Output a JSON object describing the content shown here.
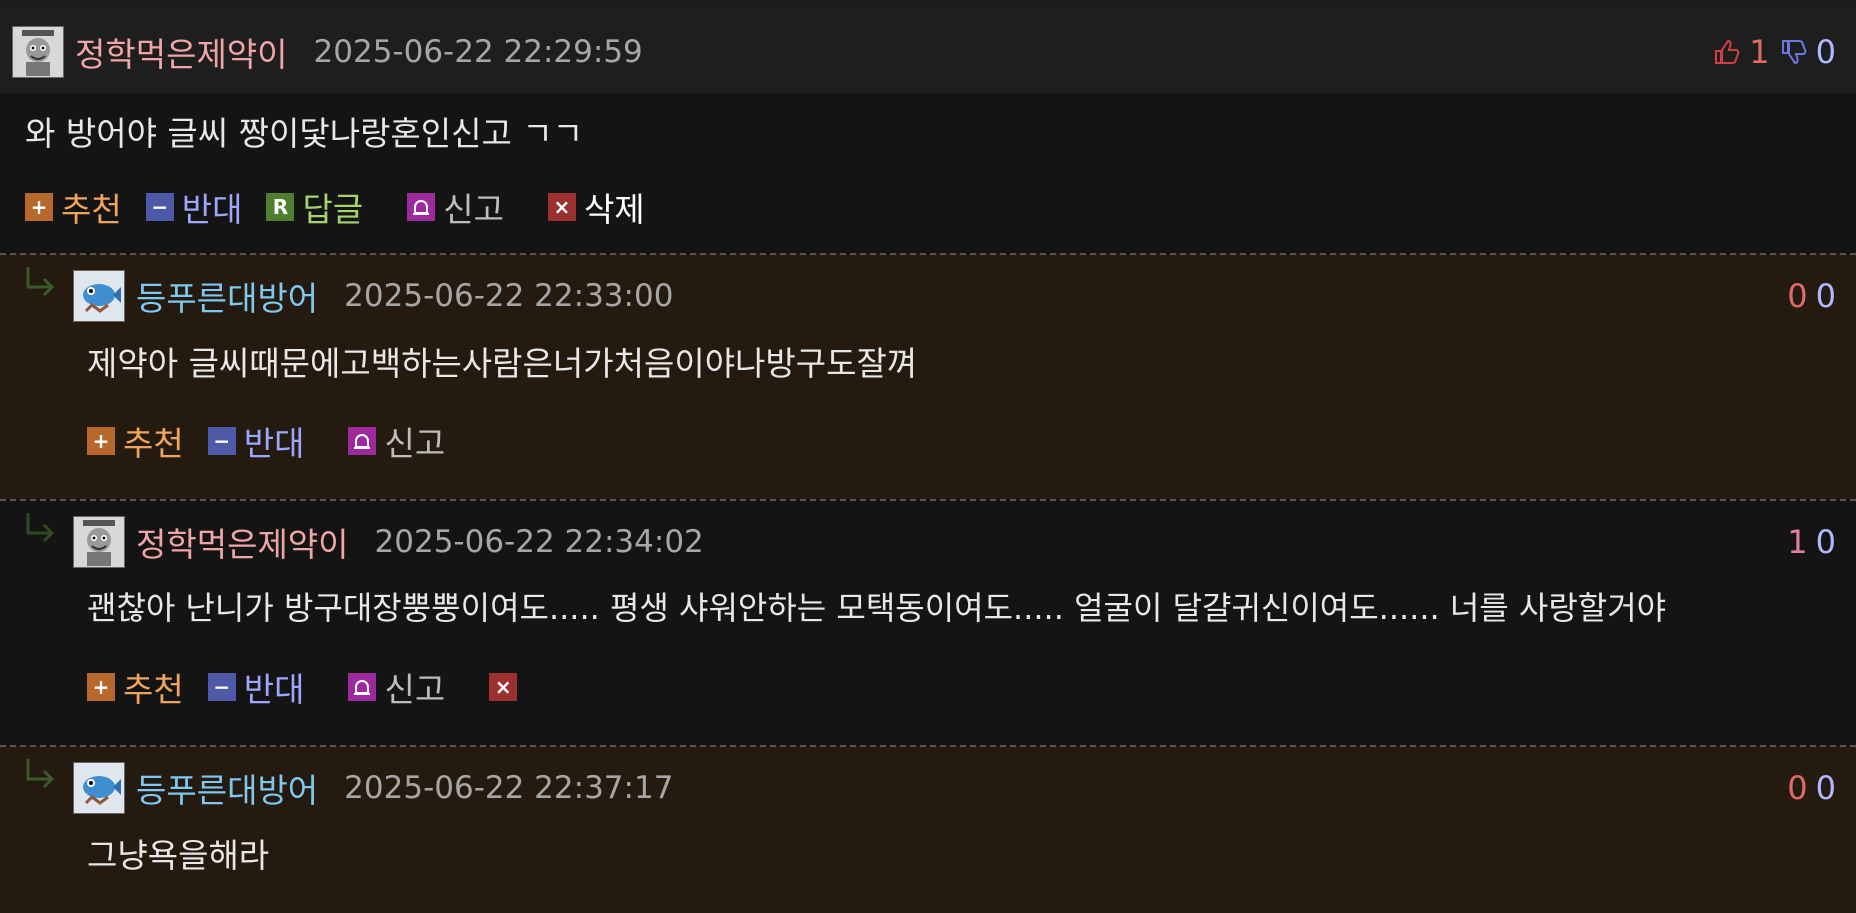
{
  "comments": [
    {
      "nickname": "정학먹은제약이",
      "date": "2025-06-22 22:29:59",
      "up": "1",
      "down": "0",
      "text": "와 방어야 글씨 짱이닻나랑혼인신고 ㄱㄱ",
      "actions": {
        "recommend": "추천",
        "oppose": "반대",
        "reply": "답글",
        "report": "신고",
        "delete": "삭제"
      }
    },
    {
      "nickname": "등푸른대방어",
      "date": "2025-06-22 22:33:00",
      "up": "0",
      "down": "0",
      "text": "제약아 글씨때문에고백하는사람은너가처음이야나방구도잘껴",
      "actions": {
        "recommend": "추천",
        "oppose": "반대",
        "report": "신고"
      }
    },
    {
      "nickname": "정학먹은제약이",
      "date": "2025-06-22 22:34:02",
      "up": "1",
      "down": "0",
      "text": "괜찮아 난니가 방구대장뿡뿡이여도..... 평생 샤워안하는 모택동이여도..... 얼굴이 달걀귀신이여도...... 너를 사랑할거야",
      "actions": {
        "recommend": "추천",
        "oppose": "반대",
        "report": "신고"
      }
    },
    {
      "nickname": "등푸른대방어",
      "date": "2025-06-22 22:37:17",
      "up": "0",
      "down": "0",
      "text": "그냥욕을해라"
    }
  ],
  "colors": {
    "nick_pink": "#f0a6a6",
    "nick_blue": "#7fc8f0",
    "reply_bg": "#241a0f",
    "base_bg": "#141414"
  }
}
